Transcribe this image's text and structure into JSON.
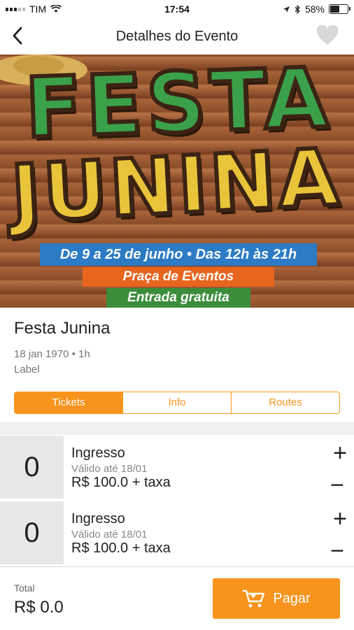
{
  "status_bar": {
    "carrier": "TIM",
    "time": "17:54",
    "battery": "58%",
    "battery_level": 0.58
  },
  "nav": {
    "title": "Detalhes do Evento",
    "back_icon": "chevron-left-icon",
    "favorite_icon": "heart-icon"
  },
  "banner": {
    "title_line1": "FESTA",
    "title_line2": "JUNINA",
    "dates": "De 9 a 25 de junho • Das 12h às 21h",
    "place": "Praça de Eventos",
    "entry": "Entrada gratuita",
    "colors": {
      "dates": "#2c7bc4",
      "place": "#e8651e",
      "entry": "#3b8d3b"
    }
  },
  "event": {
    "title": "Festa Junina",
    "meta": "18 jan 1970 • 1h",
    "label": "Label"
  },
  "tabs": [
    {
      "label": "Tickets",
      "active": true
    },
    {
      "label": "Info",
      "active": false
    },
    {
      "label": "Routes",
      "active": false
    }
  ],
  "tickets": [
    {
      "quantity": "0",
      "name": "Ingresso",
      "valid": "Válido até 18/01",
      "price": "R$ 100.0 + taxa",
      "plus": "+",
      "minus": "−"
    },
    {
      "quantity": "0",
      "name": "Ingresso",
      "valid": "Válido até 18/01",
      "price": "R$ 100.0 + taxa",
      "plus": "+",
      "minus": "−"
    }
  ],
  "footer": {
    "total_label": "Total",
    "total_value": "R$ 0.0",
    "pay_label": "Pagar",
    "pay_icon": "cart-icon"
  },
  "theme": {
    "accent": "#f7941d"
  }
}
